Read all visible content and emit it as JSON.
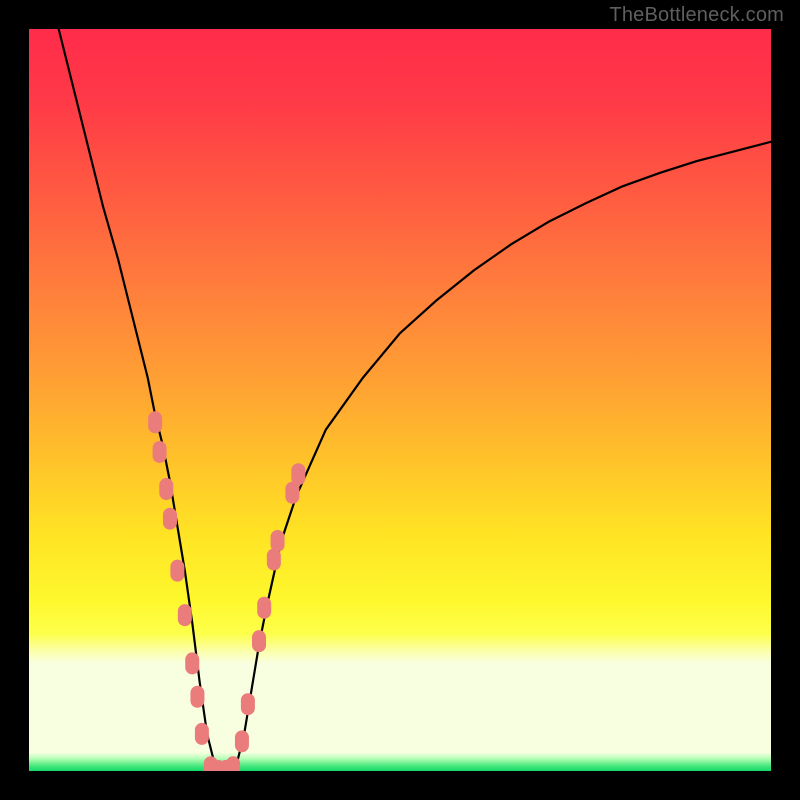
{
  "watermark": "TheBottleneck.com",
  "colors": {
    "black": "#000000",
    "curve": "#000000",
    "dot": "#eb7c7c",
    "gradient_stops": [
      {
        "offset": 0.0,
        "color": "#ff2b4a"
      },
      {
        "offset": 0.1,
        "color": "#ff3a47"
      },
      {
        "offset": 0.22,
        "color": "#ff5a41"
      },
      {
        "offset": 0.35,
        "color": "#ff7e3c"
      },
      {
        "offset": 0.48,
        "color": "#ffa233"
      },
      {
        "offset": 0.58,
        "color": "#ffc22a"
      },
      {
        "offset": 0.68,
        "color": "#ffe324"
      },
      {
        "offset": 0.77,
        "color": "#fef82d"
      },
      {
        "offset": 0.815,
        "color": "#fdff4a"
      },
      {
        "offset": 0.84,
        "color": "#fbffb0"
      },
      {
        "offset": 0.855,
        "color": "#f8ffe0"
      },
      {
        "offset": 0.975,
        "color": "#f8ffe0"
      },
      {
        "offset": 0.983,
        "color": "#b8ffb8"
      },
      {
        "offset": 0.993,
        "color": "#48e87c"
      },
      {
        "offset": 1.0,
        "color": "#13d86a"
      }
    ]
  },
  "chart_data": {
    "type": "line",
    "title": "",
    "xlabel": "",
    "ylabel": "",
    "xlim": [
      0,
      100
    ],
    "ylim": [
      0,
      100
    ],
    "note": "V-shaped bottleneck curve; y is bottleneck percentage (0 = no bottleneck at bottom, 100 = max at top). x is relative component ratio. Values estimated from pixels.",
    "series": [
      {
        "name": "bottleneck-curve",
        "x": [
          4,
          6,
          8,
          10,
          12,
          14,
          16,
          17,
          18,
          19,
          20,
          21,
          22,
          23,
          24,
          25,
          25.8,
          26.8,
          28,
          29,
          30,
          31,
          32,
          34,
          36,
          40,
          45,
          50,
          55,
          60,
          65,
          70,
          75,
          80,
          85,
          90,
          95,
          100
        ],
        "y": [
          100,
          92,
          84,
          76,
          69,
          61,
          53,
          48,
          44,
          39,
          33,
          27,
          20,
          12,
          5,
          1,
          0,
          0,
          1,
          5,
          11,
          17,
          22,
          31,
          37,
          46,
          53,
          59,
          63.5,
          67.5,
          71,
          74,
          76.5,
          78.8,
          80.6,
          82.2,
          83.5,
          84.8
        ]
      }
    ],
    "scatter_points": {
      "name": "highlighted-points",
      "note": "Salmon dots near the valley of the curve, estimated (x in 0-100, y in 0-100).",
      "points": [
        [
          17.0,
          47.0
        ],
        [
          17.6,
          43.0
        ],
        [
          18.5,
          38.0
        ],
        [
          19.0,
          34.0
        ],
        [
          20.0,
          27.0
        ],
        [
          21.0,
          21.0
        ],
        [
          22.0,
          14.5
        ],
        [
          22.7,
          10.0
        ],
        [
          23.3,
          5.0
        ],
        [
          24.5,
          0.5
        ],
        [
          25.5,
          0.0
        ],
        [
          26.5,
          0.0
        ],
        [
          27.5,
          0.5
        ],
        [
          28.7,
          4.0
        ],
        [
          29.5,
          9.0
        ],
        [
          31.0,
          17.5
        ],
        [
          31.7,
          22.0
        ],
        [
          33.0,
          28.5
        ],
        [
          33.5,
          31.0
        ],
        [
          35.5,
          37.5
        ],
        [
          36.3,
          40.0
        ]
      ]
    }
  }
}
